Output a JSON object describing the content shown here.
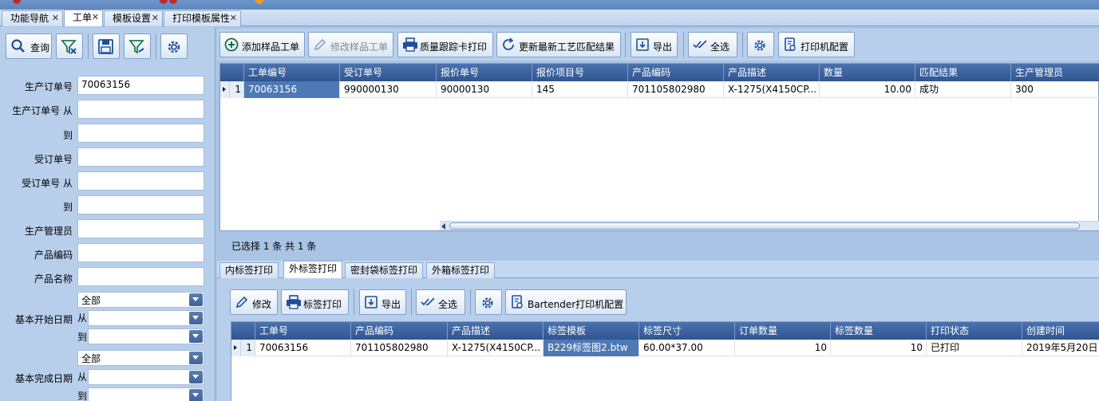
{
  "doc_tabs": [
    {
      "label": "功能导航",
      "active": false
    },
    {
      "label": "工单",
      "active": true
    },
    {
      "label": "模板设置",
      "active": false
    },
    {
      "label": "打印模板属性",
      "active": false
    }
  ],
  "filter": {
    "query_label": "查询",
    "fields": {
      "prod_order": {
        "label": "生产订单号",
        "value": "70063156"
      },
      "prod_order_from": {
        "label": "生产订单号 从",
        "value": ""
      },
      "prod_order_to": {
        "label": "到",
        "value": ""
      },
      "sales_order": {
        "label": "受订单号",
        "value": ""
      },
      "sales_order_from": {
        "label": "受订单号 从",
        "value": ""
      },
      "sales_order_to": {
        "label": "到",
        "value": ""
      },
      "prod_manager": {
        "label": "生产管理员",
        "value": ""
      },
      "product_code": {
        "label": "产品编码",
        "value": ""
      },
      "product_name": {
        "label": "产品名称",
        "value": ""
      }
    },
    "start_date": {
      "label": "基本开始日期",
      "mode": "全部",
      "from_label": "从",
      "to_label": "到"
    },
    "finish_date": {
      "label": "基本完成日期",
      "mode": "全部",
      "from_label": "从",
      "to_label": "到"
    }
  },
  "toolbar": {
    "add_sample": "添加样品工单",
    "edit_sample": "修改样品工单",
    "quality_print": "质量跟踪卡打印",
    "update_match": "更新最新工艺匹配结果",
    "export": "导出",
    "select_all": "全选",
    "printer_config": "打印机配置"
  },
  "work_orders": {
    "columns": [
      "工单编号",
      "受订单号",
      "报价单号",
      "报价项目号",
      "产品编码",
      "产品描述",
      "数量",
      "匹配结果",
      "生产管理员"
    ],
    "rows": [
      {
        "index": "1",
        "cells": [
          "70063156",
          "990000130",
          "90000130",
          "145",
          "701105802980",
          "X-1275(X4150CP...",
          "10.00",
          "成功",
          "300"
        ]
      }
    ],
    "status": "已选择 1 条  共 1 条"
  },
  "sub_tabs": [
    {
      "label": "内标签打印",
      "active": false
    },
    {
      "label": "外标签打印",
      "active": true
    },
    {
      "label": "密封袋标签打印",
      "active": false
    },
    {
      "label": "外箱标签打印",
      "active": false
    }
  ],
  "sub_toolbar": {
    "edit": "修改",
    "label_print": "标签打印",
    "export": "导出",
    "select_all": "全选",
    "bartender_config": "Bartender打印机配置"
  },
  "labels": {
    "columns": [
      "工单号",
      "产品编码",
      "产品描述",
      "标签模板",
      "标签尺寸",
      "订单数量",
      "标签数量",
      "打印状态",
      "创建时间"
    ],
    "rows": [
      {
        "index": "1",
        "cells": [
          "70063156",
          "701105802980",
          "X-1275(X4150CP...",
          "B229标签图2.btw",
          "60.00*37.00",
          "10",
          "10",
          "已打印",
          "2019年5月20日"
        ]
      }
    ]
  },
  "colors": {
    "accent": "#2f5592",
    "selection": "#4f79b5",
    "panel": "#b8cfeb"
  }
}
